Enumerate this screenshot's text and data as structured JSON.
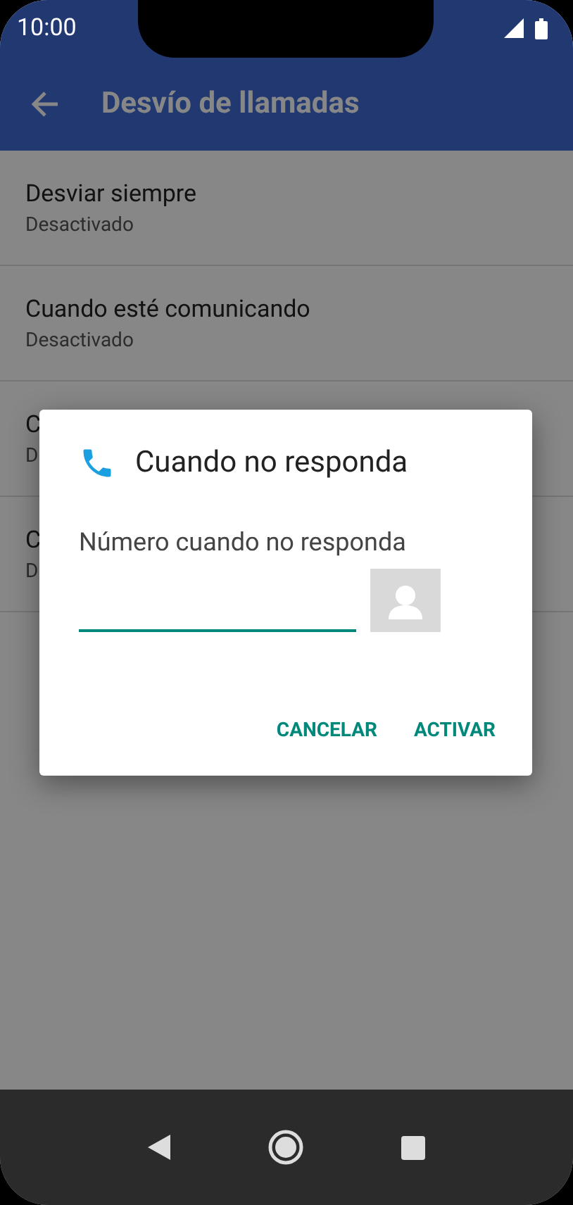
{
  "status_bar": {
    "time": "10:00"
  },
  "app_bar": {
    "title": "Desvío de llamadas"
  },
  "list": [
    {
      "title": "Desviar siempre",
      "subtitle": "Desactivado"
    },
    {
      "title": "Cuando esté comunicando",
      "subtitle": "Desactivado"
    },
    {
      "title": "C",
      "subtitle": "D"
    },
    {
      "title": "C",
      "subtitle": "D"
    }
  ],
  "dialog": {
    "title": "Cuando no responda",
    "label": "Número cuando no responda",
    "buttons": [
      "CANCELAR",
      "ACTIVAR"
    ]
  }
}
